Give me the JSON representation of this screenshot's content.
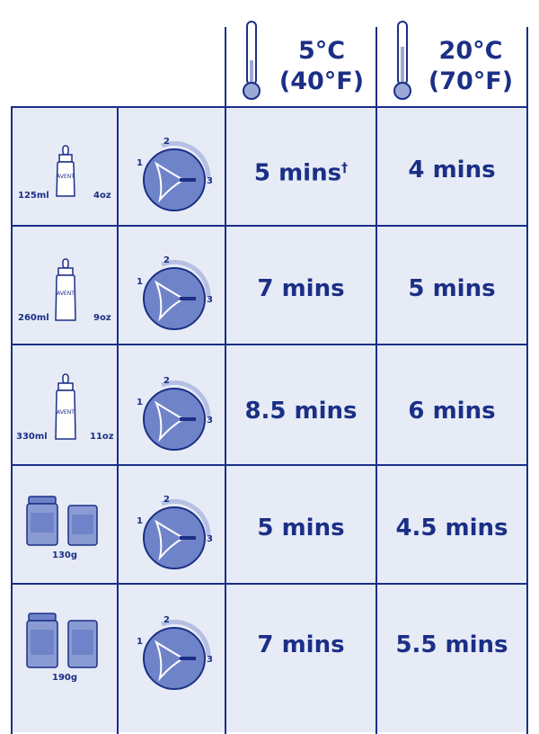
{
  "header": {
    "col1": {
      "line1": "5°C",
      "line2": "(40°F)"
    },
    "col2": {
      "line1": "20°C",
      "line2": "(70°F)"
    }
  },
  "rows": [
    {
      "type": "bottle",
      "left_label": "125ml",
      "right_label": "4oz",
      "bottle_brand": "AVENT",
      "dial": {
        "labels": [
          "1",
          "2",
          "3"
        ]
      },
      "t5": "5 mins",
      "t5_mark": "†",
      "t20": "4 mins"
    },
    {
      "type": "bottle",
      "left_label": "260ml",
      "right_label": "9oz",
      "bottle_brand": "AVENT",
      "dial": {
        "labels": [
          "1",
          "2",
          "3"
        ]
      },
      "t5": "7 mins",
      "t20": "5 mins"
    },
    {
      "type": "bottle",
      "left_label": "330ml",
      "right_label": "11oz",
      "bottle_brand": "AVENT",
      "dial": {
        "labels": [
          "1",
          "2",
          "3"
        ]
      },
      "t5": "8.5 mins",
      "t20": "6 mins"
    },
    {
      "type": "jar",
      "label": "130g",
      "dial": {
        "labels": [
          "1",
          "2",
          "3"
        ]
      },
      "t5": "5 mins",
      "t20": "4.5 mins"
    },
    {
      "type": "jar",
      "label": "190g",
      "dial": {
        "labels": [
          "1",
          "2",
          "3"
        ]
      },
      "t5": "7 mins",
      "t20": "5.5 mins"
    }
  ],
  "colors": {
    "ink": "#1b2f86",
    "cell": "#e6ebf6",
    "dial": "#6f84c8"
  },
  "icons": [
    "thermometer-icon",
    "bottle-icon",
    "jar-icon",
    "dial-icon"
  ]
}
